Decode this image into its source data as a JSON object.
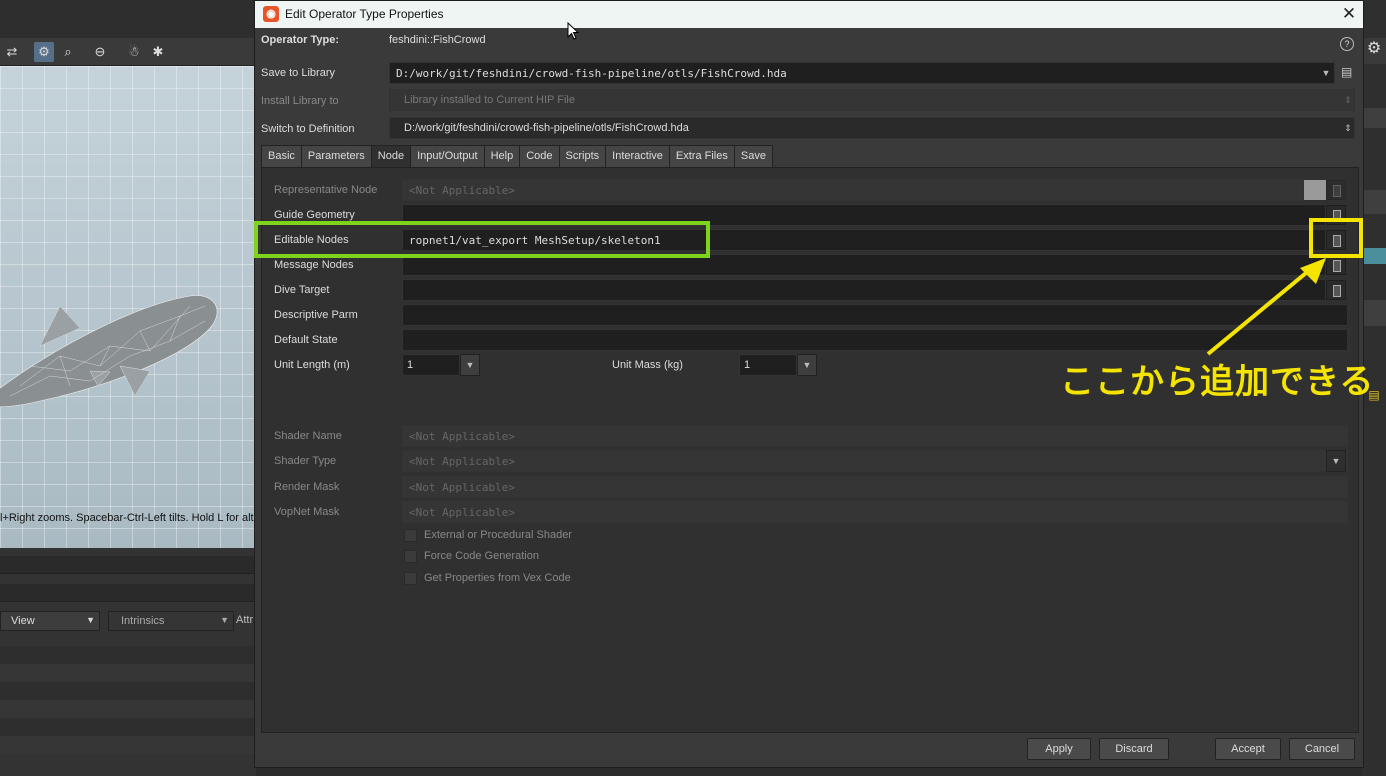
{
  "background": {
    "viewport_hint": "l+Right zooms. Spacebar-Ctrl-Left tilts. Hold L for alt",
    "view_dropdown": "View",
    "intrinsics_dropdown": "Intrinsics",
    "attr_label": "Attr"
  },
  "dialog": {
    "title": "Edit Operator Type Properties",
    "operator_type_label": "Operator Type:",
    "operator_type_value": "feshdini::FishCrowd",
    "save_to_library_label": "Save to Library",
    "save_to_library_value": "D:/work/git/feshdini/crowd-fish-pipeline/otls/FishCrowd.hda",
    "install_library_label": "Install Library to",
    "install_library_value": "Library installed to Current HIP File",
    "switch_definition_label": "Switch to Definition",
    "switch_definition_value": "D:/work/git/feshdini/crowd-fish-pipeline/otls/FishCrowd.hda",
    "tabs": [
      "Basic",
      "Parameters",
      "Node",
      "Input/Output",
      "Help",
      "Code",
      "Scripts",
      "Interactive",
      "Extra Files",
      "Save"
    ],
    "active_tab": "Node",
    "node": {
      "representative_node_label": "Representative Node",
      "representative_node_placeholder": "<Not Applicable>",
      "guide_geometry_label": "Guide Geometry",
      "guide_geometry_value": "",
      "editable_nodes_label": "Editable Nodes",
      "editable_nodes_value": "ropnet1/vat_export MeshSetup/skeleton1",
      "message_nodes_label": "Message Nodes",
      "dive_target_label": "Dive Target",
      "descriptive_parm_label": "Descriptive Parm",
      "default_state_label": "Default State",
      "unit_length_label": "Unit Length (m)",
      "unit_length_value": "1",
      "unit_mass_label": "Unit Mass (kg)",
      "unit_mass_value": "1",
      "shader_name_label": "Shader Name",
      "shader_type_label": "Shader Type",
      "render_mask_label": "Render Mask",
      "vopnet_mask_label": "VopNet Mask",
      "not_applicable": "<Not Applicable>",
      "external_shader_label": "External or Procedural Shader",
      "force_code_label": "Force Code Generation",
      "get_properties_label": "Get Properties from Vex Code"
    },
    "buttons": {
      "apply": "Apply",
      "discard": "Discard",
      "accept": "Accept",
      "cancel": "Cancel"
    }
  },
  "annotation": {
    "text": "ここから追加できる",
    "highlight_color_green": "#7ed31c",
    "highlight_color_yellow": "#f5e400"
  }
}
